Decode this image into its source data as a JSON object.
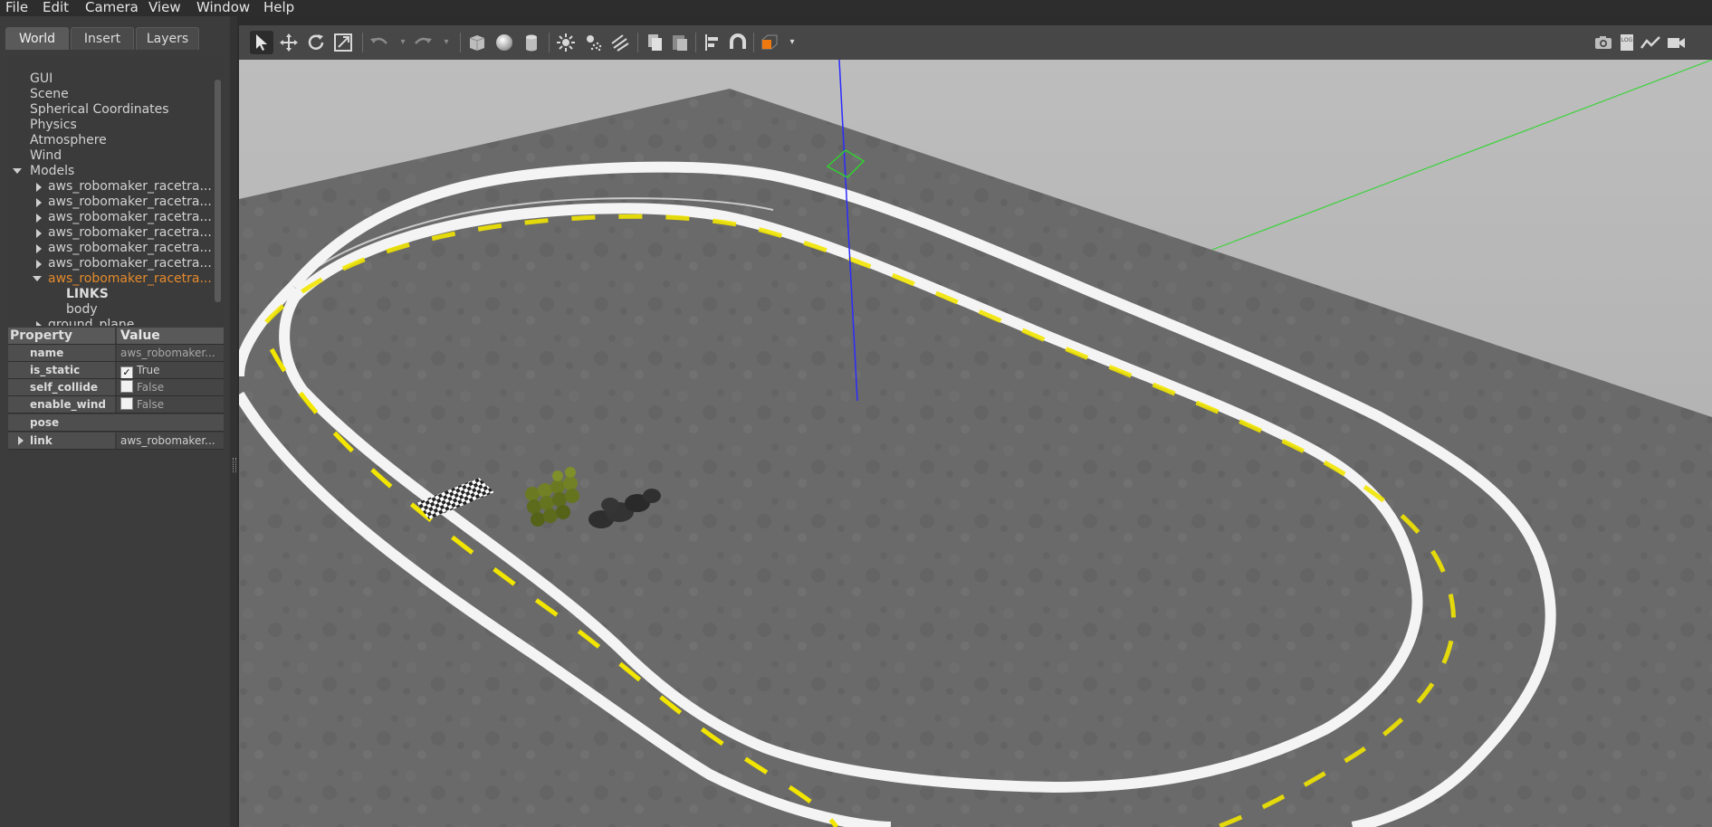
{
  "menu": [
    "File",
    "Edit",
    "Camera",
    "View",
    "Window",
    "Help"
  ],
  "tabs": [
    "World",
    "Insert",
    "Layers"
  ],
  "tree": {
    "top_items": [
      "GUI",
      "Scene",
      "Spherical Coordinates",
      "Physics",
      "Atmosphere",
      "Wind"
    ],
    "models_label": "Models",
    "model_items": [
      "aws_robomaker_racetra...",
      "aws_robomaker_racetra...",
      "aws_robomaker_racetra...",
      "aws_robomaker_racetra...",
      "aws_robomaker_racetra...",
      "aws_robomaker_racetra..."
    ],
    "selected_model": "aws_robomaker_racetra...",
    "links_label": "LINKS",
    "link_item": "body",
    "ground_plane": "ground_plane"
  },
  "properties": {
    "header_property": "Property",
    "header_value": "Value",
    "rows": [
      {
        "key": "name",
        "value": "aws_robomaker..."
      },
      {
        "key": "is_static",
        "value": "True",
        "checked": true
      },
      {
        "key": "self_collide",
        "value": "False",
        "checked": false
      },
      {
        "key": "enable_wind",
        "value": "False",
        "checked": false
      }
    ],
    "pose_label": "pose",
    "link_label": "link",
    "link_value": "aws_robomaker..."
  },
  "toolbar_icons": [
    "select-mode",
    "translate-mode",
    "rotate-mode",
    "scale-mode",
    "undo",
    "redo",
    "box-shape",
    "sphere-shape",
    "cylinder-shape",
    "point-light",
    "spot-light",
    "directional-light",
    "copy",
    "paste",
    "align",
    "snap",
    "view-angle",
    "screenshot",
    "log",
    "plot",
    "video-record"
  ],
  "colors": {
    "selected_text": "#e58a2b",
    "lane_marking": "#f2e600",
    "track_border": "#ffffff",
    "x_axis": "#3cd23c",
    "z_axis": "#2b2bff"
  }
}
